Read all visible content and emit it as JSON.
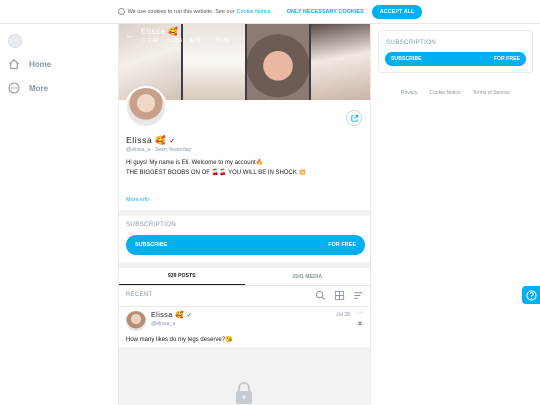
{
  "cookie": {
    "text": "We use cookies to run this website. See our",
    "link": "Cookie Notice",
    "btn_necessary": "ONLY NECESSARY COOKIES",
    "btn_accept": "ACCEPT ALL"
  },
  "sidebar": {
    "items": [
      {
        "label": "Home",
        "icon": "home-icon"
      },
      {
        "label": "More",
        "icon": "more-icon"
      }
    ]
  },
  "profile": {
    "cover_title": "Elissa 🥰",
    "cover_stats": {
      "photos": "2.4K",
      "videos": "153",
      "streams": "11",
      "likes": "77.7K"
    },
    "name": "Elissa 🥰",
    "handle": "@elissa_a",
    "seen": "Seen Yesterday",
    "bio_line1": "Hi guys! My name is Eli. Welcome to my account🔥",
    "bio_line2": "THE BIGGEST BOOBS ON OF 🍒🍒 YOU WILL BE IN SHOCK 💥",
    "more_info": "More info"
  },
  "subscription": {
    "title": "SUBSCRIPTION",
    "btn_left": "SUBSCRIBE",
    "btn_right": "FOR FREE"
  },
  "tabs": [
    {
      "label": "939 POSTS",
      "active": true
    },
    {
      "label": "2541 MEDIA",
      "active": false
    }
  ],
  "feed": {
    "section_title": "RECENT",
    "post": {
      "author": "Elissa 🥰",
      "handle": "@elissa_a",
      "date": "Jul 28",
      "text": "How many likes do my legs deserve?😘"
    }
  },
  "right_panel": {
    "title": "SUBSCRIPTION",
    "btn_left": "SUBSCRIBE",
    "btn_right": "FOR FREE"
  },
  "footer": [
    "Privacy",
    "Cookie Notice",
    "Terms of Service"
  ],
  "colors": {
    "accent": "#00aff0",
    "muted": "#8a96a3"
  }
}
